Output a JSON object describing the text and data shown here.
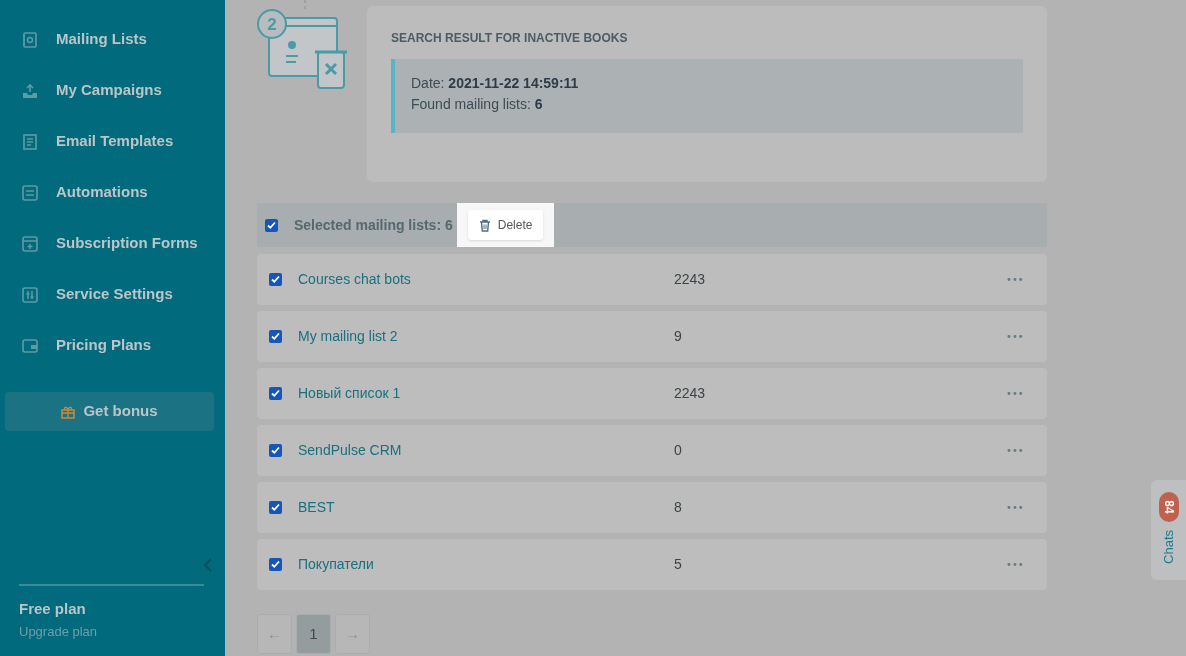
{
  "sidebar": {
    "items": [
      {
        "label": "Mailing Lists",
        "kind": "book"
      },
      {
        "label": "My Campaigns",
        "kind": "send"
      },
      {
        "label": "Email Templates",
        "kind": "template"
      },
      {
        "label": "Automations",
        "kind": "automation"
      },
      {
        "label": "Subscription Forms",
        "kind": "form"
      },
      {
        "label": "Service Settings",
        "kind": "sliders"
      },
      {
        "label": "Pricing Plans",
        "kind": "wallet"
      }
    ],
    "bonus_button": "Get bonus",
    "plan": "Free plan",
    "upgrade_link": "Upgrade plan"
  },
  "step_number": "2",
  "result": {
    "title": "SEARCH RESULT FOR INACTIVE BOOKS",
    "date_label": "Date: ",
    "date": "2021-11-22 14:59:11",
    "found_label": "Found mailing lists: ",
    "found": "6"
  },
  "selection": {
    "checked": true,
    "label": "Selected mailing lists: 6",
    "delete_button": "Delete"
  },
  "rows": [
    {
      "checked": true,
      "name": "Courses chat bots",
      "count": "2243",
      "menu": "•••"
    },
    {
      "checked": true,
      "name": "My mailing list 2",
      "count": "9",
      "menu": "•••"
    },
    {
      "checked": true,
      "name": "Новый список 1",
      "count": "2243",
      "menu": "•••"
    },
    {
      "checked": true,
      "name": "SendPulse CRM",
      "count": "0",
      "menu": "•••"
    },
    {
      "checked": true,
      "name": "BEST",
      "count": "8",
      "menu": "•••"
    },
    {
      "checked": true,
      "name": "Покупатели",
      "count": "5",
      "menu": "•••"
    }
  ],
  "pagination": {
    "prev": "←",
    "pages": [
      {
        "label": "1",
        "selected": true
      }
    ],
    "next": "→"
  },
  "chats": {
    "label": "Chats",
    "count": "84"
  }
}
